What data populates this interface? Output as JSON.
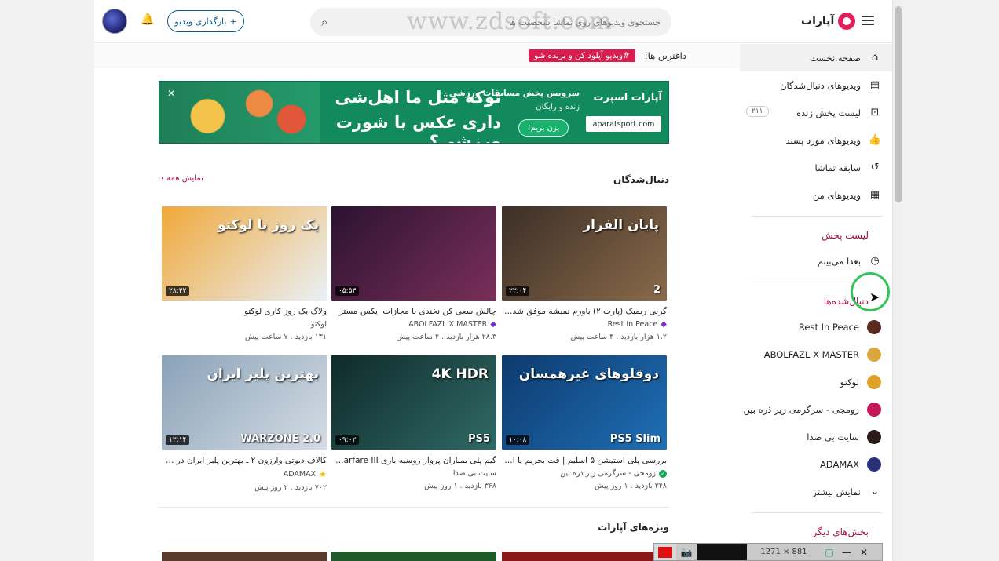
{
  "header": {
    "logo_text": "آپارات",
    "search_placeholder": "جستجوی ویدیوهای روی تماشا شخصیت ها",
    "watermark": "www.zdsoft.com",
    "upload_label": "بارگذاری ویدیو",
    "upload_icon": "+"
  },
  "topline": {
    "label": "داغترین ها:",
    "tag": "#ویدیو آپلود کن و برنده شو"
  },
  "banner": {
    "headline1": "توکه مثل ما اهل‌شی",
    "headline2": "داری عکس با شورت ورزشی؟",
    "sub1": "سرویس پخش مسابقات ورزشی",
    "sub2": "زنده و رایگان",
    "cta": "بزن بریم!",
    "brand": "آپارات اسپرت",
    "domain": "aparatsport.com",
    "close": "✕"
  },
  "sections": {
    "following_title": "دنبال‌شدگان",
    "show_all": "نمایش همه ›",
    "specials_title": "ویژه‌های آپارات"
  },
  "cards": [
    {
      "thumb_text": "پایان الفرار",
      "badge_num": "2",
      "duration": "۲۲:۰۴",
      "title": "گرنی ریمیک (پارت ۲) باورم نمیشه موفق شدم و...",
      "channel": "Rest In Peace",
      "badge": "diamond",
      "meta": "۱.۲ هزار بازدید . ۴ ساعت پیش",
      "colors": [
        "#3b2e26",
        "#8a6a4a"
      ]
    },
    {
      "thumb_text": "",
      "badge_num": "",
      "duration": "۰۵:۵۳",
      "title": "چالش سعی کن نخندی با مجازات ایکس مستر",
      "channel": "ABOLFAZL X MASTER",
      "badge": "diamond",
      "meta": "۲۸.۳ هزار بازدید . ۴ ساعت پیش",
      "colors": [
        "#2b1230",
        "#7a2f5a"
      ]
    },
    {
      "thumb_text": "یک روز با لوکتو",
      "badge_num": "",
      "duration": "۲۸:۲۲",
      "title": "ولاگ یک روز کاری لوکتو",
      "channel": "لوکتو",
      "badge": "",
      "meta": "۱۳۱ بازدید . ۷ ساعت پیش",
      "colors": [
        "#f0a83a",
        "#e9f0f6"
      ]
    },
    {
      "thumb_text": "دوقلوهای غیرهمسان",
      "badge_num": "PS5 Slim",
      "duration": "۱۰:۰۸",
      "title": "بررسی پلی استیشن ۵ اسلیم | فت بخریم یا اسلی...",
      "channel": "زومجی - سرگرمی زیر ذره بین",
      "badge": "check",
      "meta": "۲۴۸ بازدید . ۱ روز پیش",
      "colors": [
        "#0d3a6e",
        "#1f6fb5"
      ]
    },
    {
      "thumb_text": "4K HDR",
      "badge_num": "PS5",
      "duration": "۰۹:۰۲",
      "title": "گیم پلی بمباران پرواز روسیه بازی rn Warfare III...",
      "channel": "سایت بی صدا",
      "badge": "",
      "meta": "۳۶۸ بازدید . ۱ روز پیش",
      "colors": [
        "#0f2a2a",
        "#2f6a66"
      ]
    },
    {
      "thumb_text": "بهترین پلیر ایران",
      "badge_num": "WARZONE 2.0",
      "duration": "۱۲:۱۴",
      "title": "کالاف دیوتی وارزون ۲ ـ بهترین پلیر ایران در وارز...",
      "channel": "ADAMAX",
      "badge": "star",
      "meta": "۷۰۲ بازدید . ۲ روز پیش",
      "colors": [
        "#8aa2b8",
        "#d5dde5"
      ]
    }
  ],
  "sidebar": {
    "main": [
      {
        "label": "صفحه نخست",
        "icon": "home-icon",
        "glyph": "⌂"
      },
      {
        "label": "ویدیوهای دنبال‌شدگان",
        "icon": "subscriptions-icon",
        "glyph": "▤"
      },
      {
        "label": "لیست پخش زنده",
        "icon": "live-icon",
        "glyph": "⊡",
        "count": "۲۱۱"
      },
      {
        "label": "ویدیوهای مورد پسند",
        "icon": "like-icon",
        "glyph": "👍"
      },
      {
        "label": "سابقه تماشا",
        "icon": "history-icon",
        "glyph": "↺"
      },
      {
        "label": "ویدیوهای من",
        "icon": "my-videos-icon",
        "glyph": "▦"
      }
    ],
    "playlist_heading": "لیست پخش",
    "watch_later": "بعدا می‌بینم",
    "following_heading": "دنبال‌شده‌ها",
    "channels": [
      {
        "label": "Rest In Peace",
        "color": "#5a2a1e"
      },
      {
        "label": "ABOLFAZL X MASTER",
        "color": "#d8a63a"
      },
      {
        "label": "لوکتو",
        "color": "#e0a12a"
      },
      {
        "label": "زومجی - سرگرمی زیر ذره بین",
        "color": "#c3185a"
      },
      {
        "label": "سایت بی صدا",
        "color": "#2a1a1a"
      },
      {
        "label": "ADAMAX",
        "color": "#2a2f7a"
      }
    ],
    "show_more": "نمایش بیشتر",
    "other_heading": "بخش‌های دیگر"
  },
  "capture_bar": {
    "dims": "1271 × 881",
    "camera": "📷",
    "minimize": "—",
    "close": "✕"
  }
}
